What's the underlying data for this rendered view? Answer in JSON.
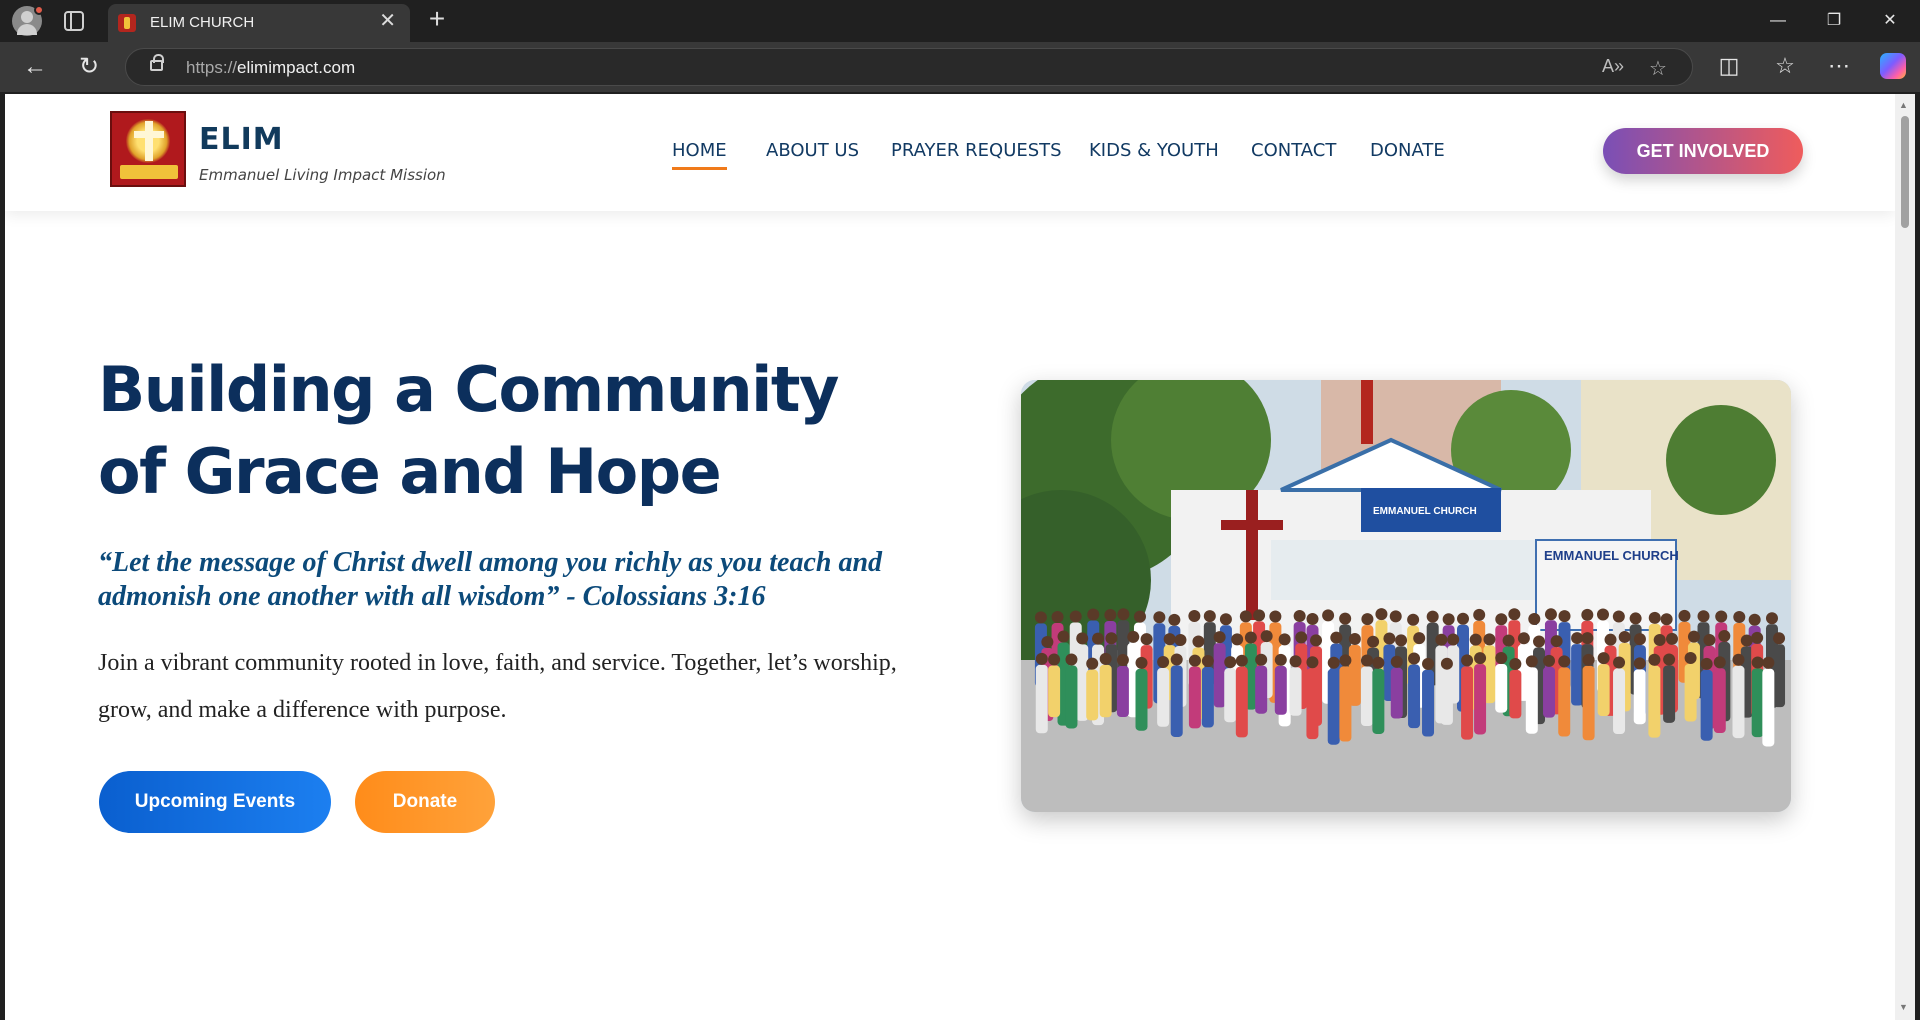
{
  "browser": {
    "tab_title": "ELIM CHURCH",
    "url_protocol": "https://",
    "url_host": "elimimpact.com",
    "icons": [
      "profile-icon",
      "tab-actions-icon",
      "close-tab-icon",
      "new-tab-icon",
      "minimize-icon",
      "restore-icon",
      "close-window-icon",
      "back-icon",
      "refresh-icon",
      "lock-icon",
      "read-aloud-icon",
      "favorite-star-icon",
      "split-screen-icon",
      "favorites-icon",
      "more-icon",
      "copilot-icon"
    ]
  },
  "site": {
    "brand": {
      "name": "ELIM",
      "tagline": "Emmanuel Living Impact Mission"
    },
    "nav": [
      {
        "label": "HOME",
        "active": true
      },
      {
        "label": "ABOUT US",
        "active": false
      },
      {
        "label": "PRAYER REQUESTS",
        "active": false
      },
      {
        "label": "KIDS & YOUTH",
        "active": false
      },
      {
        "label": "CONTACT",
        "active": false
      },
      {
        "label": "DONATE",
        "active": false
      }
    ],
    "cta": "GET INVOLVED",
    "hero": {
      "title_line1": "Building a Community",
      "title_line2": "of Grace and Hope",
      "quote": "“Let the message of Christ dwell among you richly as you teach and admonish one another with all wisdom” - Colossians 3:16",
      "body": "Join a vibrant community rooted in love, faith, and service. Together, let’s worship, grow, and make a difference with purpose.",
      "btn_events": "Upcoming Events",
      "btn_donate": "Donate"
    },
    "photo": {
      "church_sign": "EMMANUEL CHURCH",
      "banner_title": "EMMANUEL CHURCH"
    },
    "colors": {
      "accent": "#f07a1a",
      "navy": "#0c2f5c",
      "cta_from": "#7a4fb6",
      "cta_to": "#ef5c5c",
      "blue": "#0a5fcf",
      "orange": "#ff8c1a"
    }
  }
}
